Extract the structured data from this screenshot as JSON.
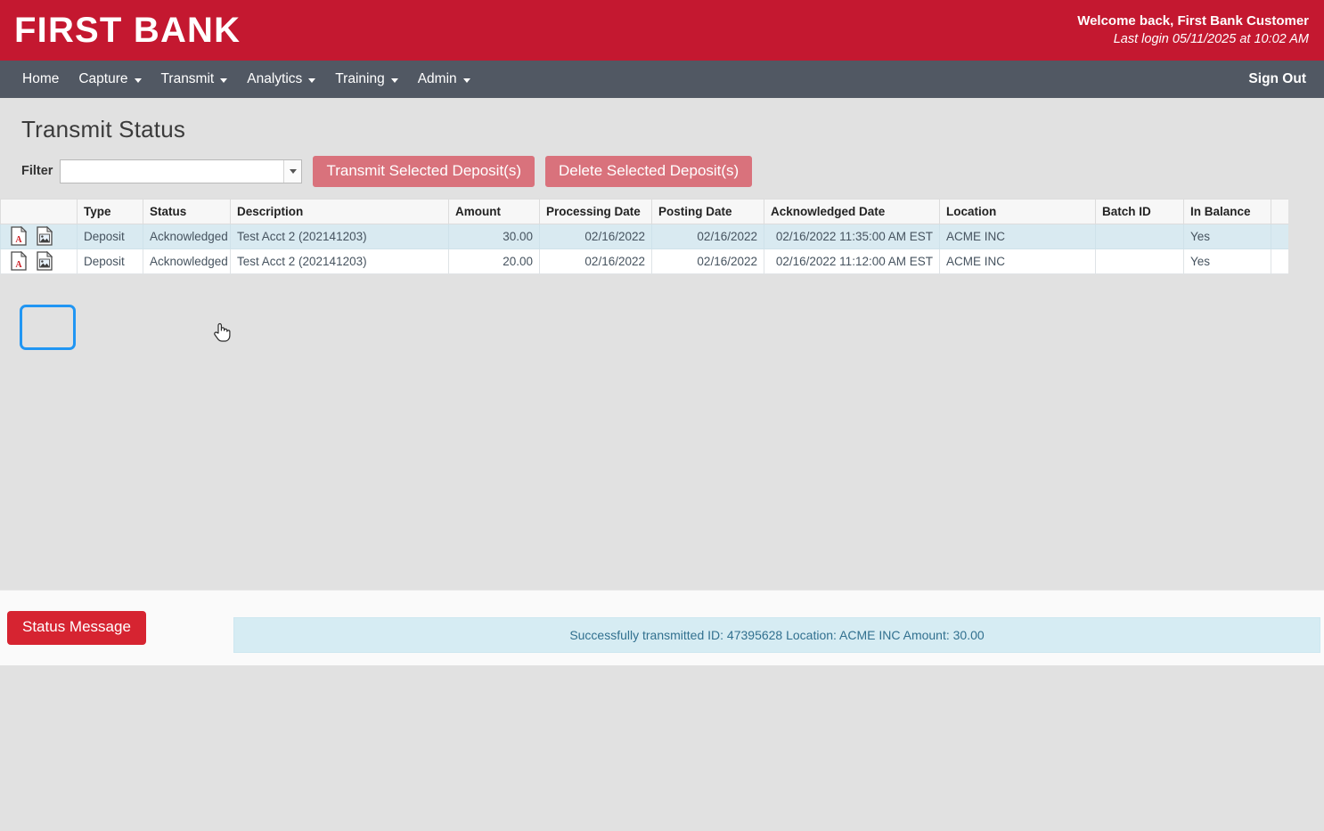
{
  "header": {
    "logo": "FIRST BANK",
    "welcome": "Welcome back, First Bank Customer",
    "last_login": "Last login 05/11/2025 at 10:02 AM",
    "brand_color": "#c41830",
    "nav_color": "#515863"
  },
  "nav": {
    "items": [
      {
        "label": "Home",
        "has_caret": false
      },
      {
        "label": "Capture",
        "has_caret": true
      },
      {
        "label": "Transmit",
        "has_caret": true
      },
      {
        "label": "Analytics",
        "has_caret": true
      },
      {
        "label": "Training",
        "has_caret": true
      },
      {
        "label": "Admin",
        "has_caret": true
      }
    ],
    "sign_out": "Sign Out"
  },
  "page": {
    "title": "Transmit Status"
  },
  "toolbar": {
    "filter_label": "Filter",
    "filter_value": "",
    "filter_placeholder": "",
    "transmit_button": "Transmit Selected Deposit(s)",
    "delete_button": "Delete Selected Deposit(s)",
    "button_color": "#d9727c"
  },
  "table": {
    "columns": [
      "",
      "Type",
      "Status",
      "Description",
      "Amount",
      "Processing Date",
      "Posting Date",
      "Acknowledged Date",
      "Location",
      "Batch ID",
      "In Balance",
      ""
    ],
    "rows": [
      {
        "icons": [
          "pdf-icon",
          "image-icon"
        ],
        "type": "Deposit",
        "status": "Acknowledged",
        "description": "Test Acct 2 (202141203)",
        "amount": "30.00",
        "processing_date": "02/16/2022",
        "posting_date": "02/16/2022",
        "acknowledged_date": "02/16/2022 11:35:00 AM EST",
        "location": "ACME INC",
        "batch_id": "",
        "in_balance": "Yes",
        "selected": true
      },
      {
        "icons": [
          "pdf-icon",
          "image-icon"
        ],
        "type": "Deposit",
        "status": "Acknowledged",
        "description": "Test Acct 2 (202141203)",
        "amount": "20.00",
        "processing_date": "02/16/2022",
        "posting_date": "02/16/2022",
        "acknowledged_date": "02/16/2022 11:12:00 AM EST",
        "location": "ACME INC",
        "batch_id": "",
        "in_balance": "Yes",
        "selected": false
      }
    ]
  },
  "status": {
    "button_label": "Status Message",
    "button_color": "#d62431",
    "message": "Successfully transmitted ID: 47395628 Location: ACME INC Amount: 30.00",
    "message_bg": "#d6ecf3"
  }
}
